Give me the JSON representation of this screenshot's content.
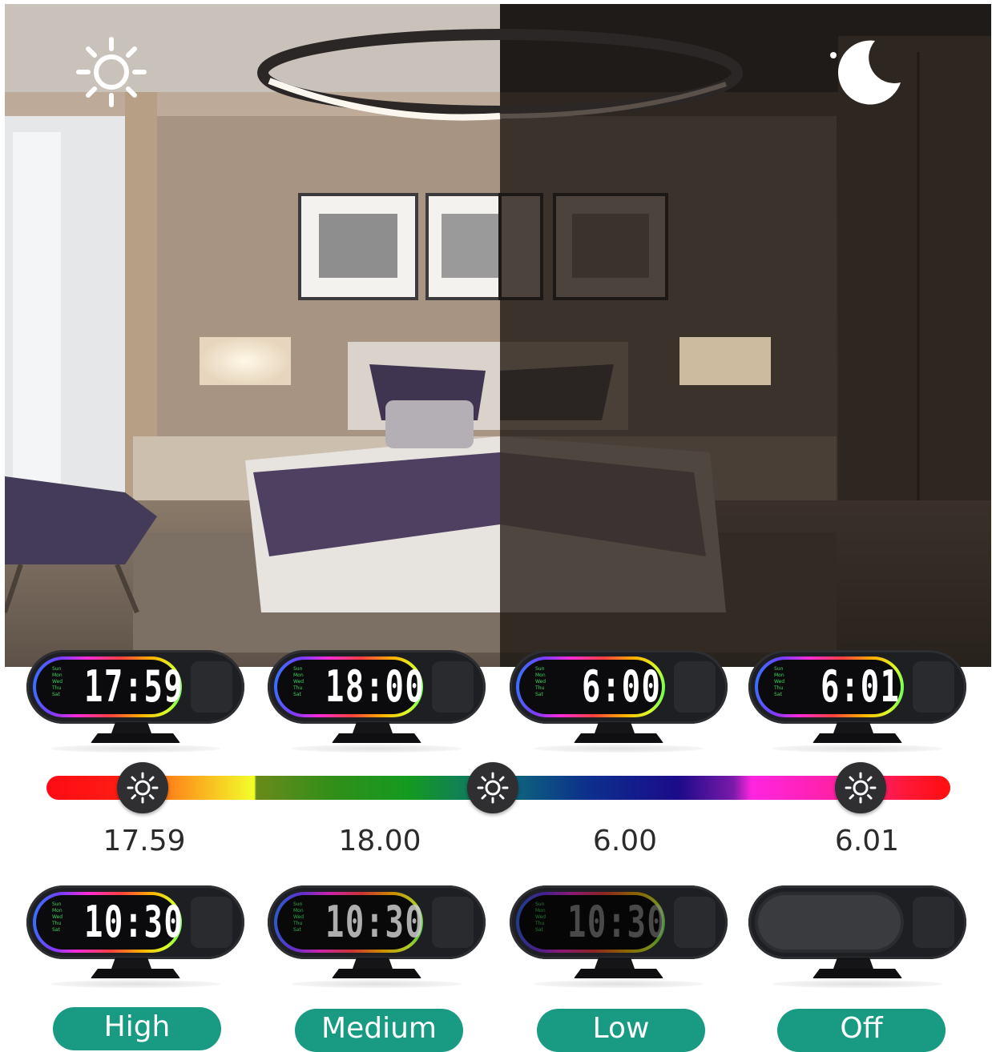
{
  "scene": {
    "day_icon": "sun-icon",
    "night_icon": "moon-icon"
  },
  "clocks_top": [
    {
      "time": "17:59"
    },
    {
      "time": "18:00"
    },
    {
      "time": "6:00"
    },
    {
      "time": "6:01"
    }
  ],
  "timeline": {
    "labels": [
      "17.59",
      "18.00",
      "6.00",
      "6.01"
    ],
    "knob_icon": "brightness-sun-icon"
  },
  "clocks_bottom": [
    {
      "time": "10:30",
      "level": "High"
    },
    {
      "time": "10:30",
      "level": "Medium"
    },
    {
      "time": "10:30",
      "level": "Low"
    },
    {
      "time": "",
      "level": "Off"
    }
  ],
  "colors": {
    "button_teal": "#199b83",
    "clock_body": "#1e1f22"
  }
}
